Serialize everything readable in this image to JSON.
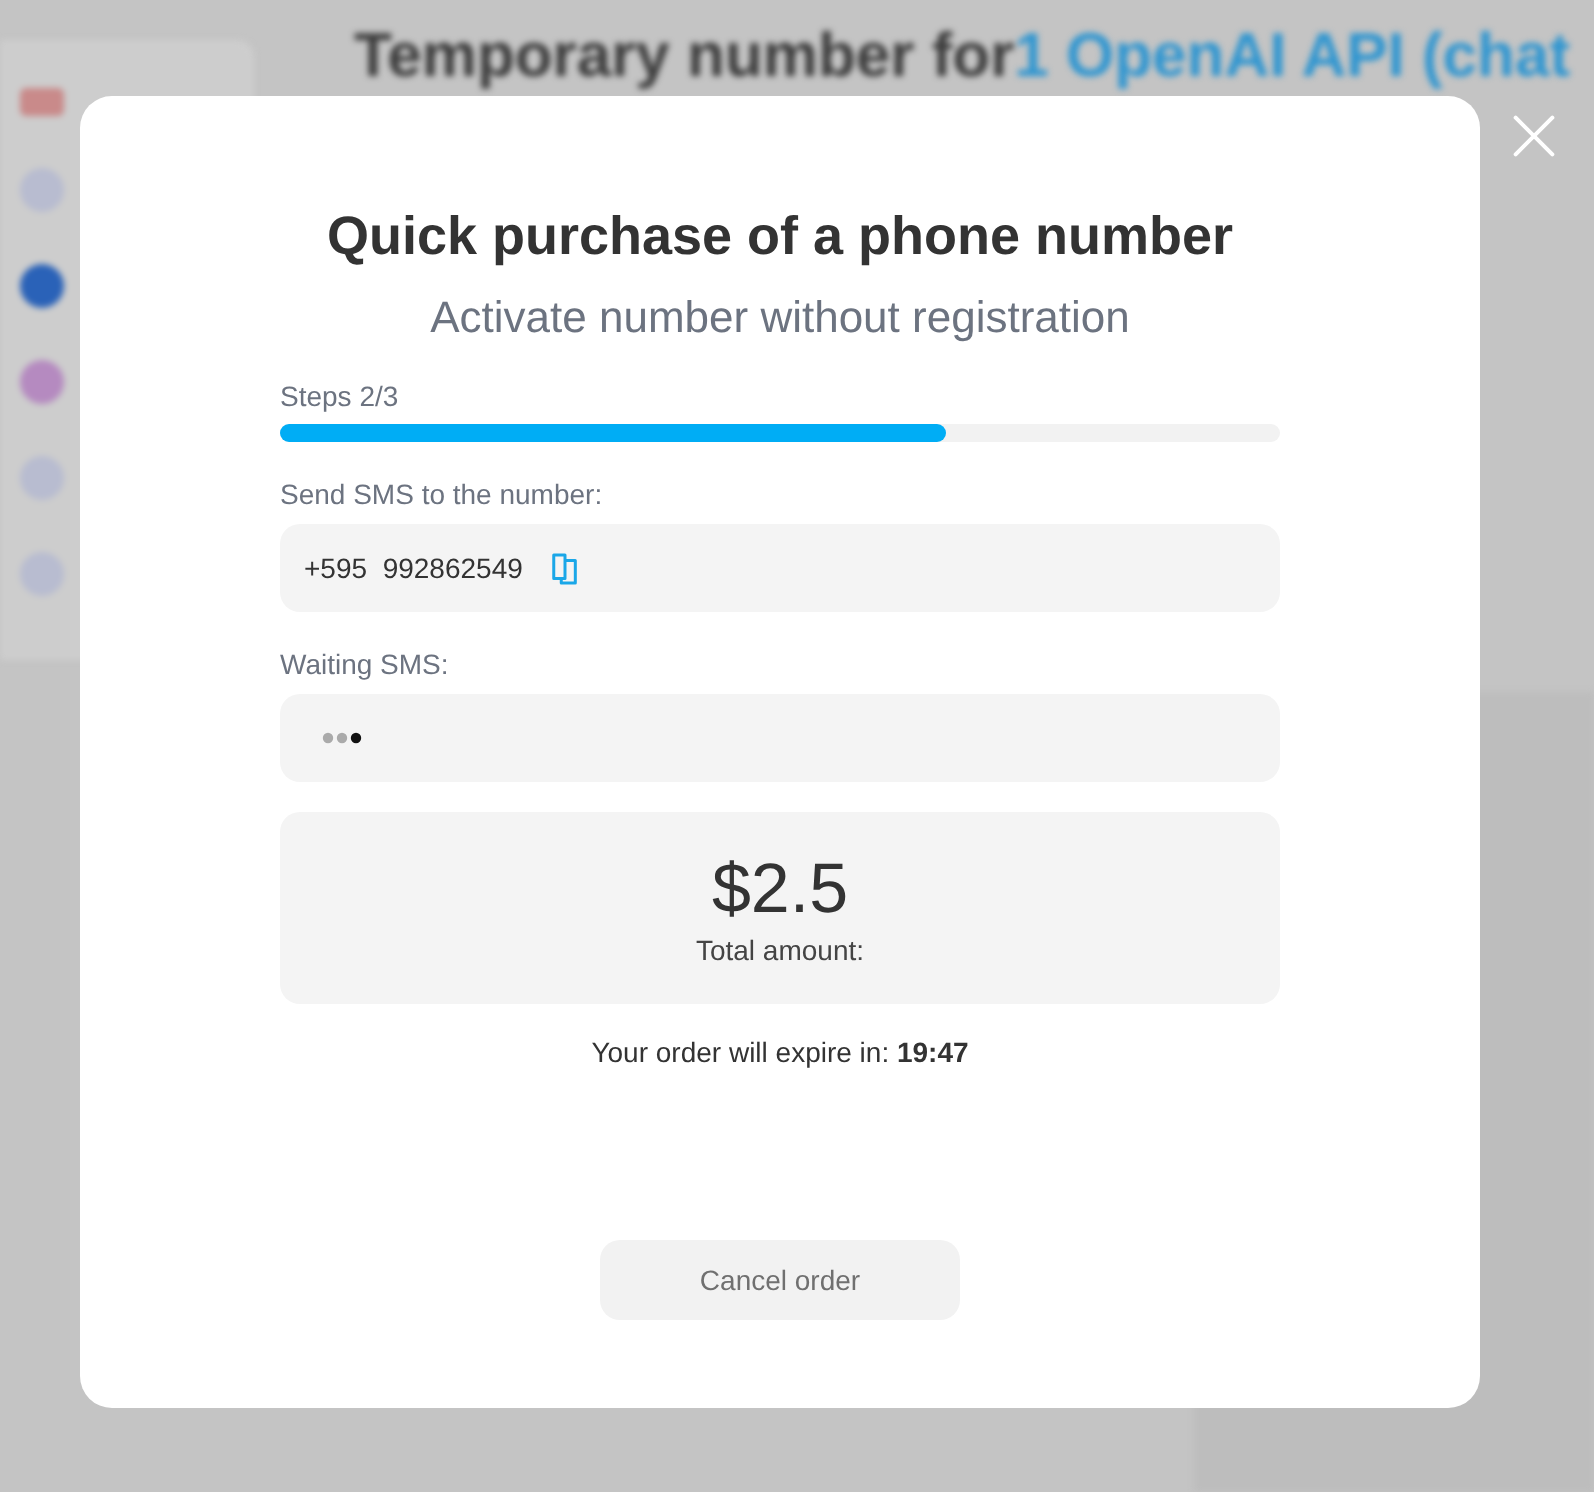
{
  "background": {
    "heading": "Temporary number for",
    "heading_link": "1 OpenAI API (chat"
  },
  "modal": {
    "title": "Quick purchase of a phone number",
    "subtitle": "Activate number without registration",
    "steps_label": "Steps 2/3",
    "progress": {
      "level": 0.666
    },
    "number_label": "Send SMS to the number:",
    "country_code": "+595",
    "number": "992862549",
    "waiting_label": "Waiting SMS:",
    "price": "$2.5",
    "price_label": "Total amount:",
    "expiry": "Your order will expire in: **19:47**",
    "cancel_button": "Cancel order"
  }
}
